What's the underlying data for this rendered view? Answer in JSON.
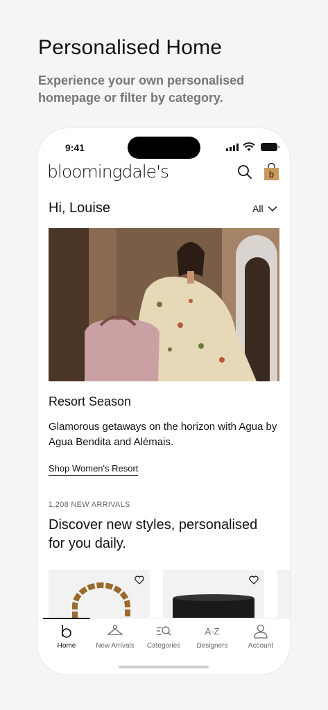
{
  "promo": {
    "title": "Personalised Home",
    "subtitle": "Experience your own personalised homepage or filter by category."
  },
  "status_bar": {
    "time": "9:41"
  },
  "header": {
    "logo": "bloomingdale's",
    "search_icon": "search-icon",
    "bag_icon": "shopping-bag-icon",
    "bag_letter": "b"
  },
  "greeting": {
    "text": "Hi, Louise",
    "filter_label": "All"
  },
  "feature": {
    "title": "Resort Season",
    "description": "Glamorous getaways on the horizon with Agua by Agua Bendita and Alémais.",
    "link": "Shop Women's Resort"
  },
  "arrivals": {
    "count": "1,208 NEW ARRIVALS",
    "title": "Discover new styles, personalised for you daily."
  },
  "tabs": [
    {
      "label": "Home",
      "icon": "b-logo-icon"
    },
    {
      "label": "New Arrivals",
      "icon": "hanger-icon"
    },
    {
      "label": "Categories",
      "icon": "categories-search-icon"
    },
    {
      "label": "Designers",
      "icon": "a-z-icon"
    },
    {
      "label": "Account",
      "icon": "person-icon"
    }
  ],
  "colors": {
    "accent_bag": "#c99a5b",
    "text": "#111111",
    "muted": "#777777"
  }
}
